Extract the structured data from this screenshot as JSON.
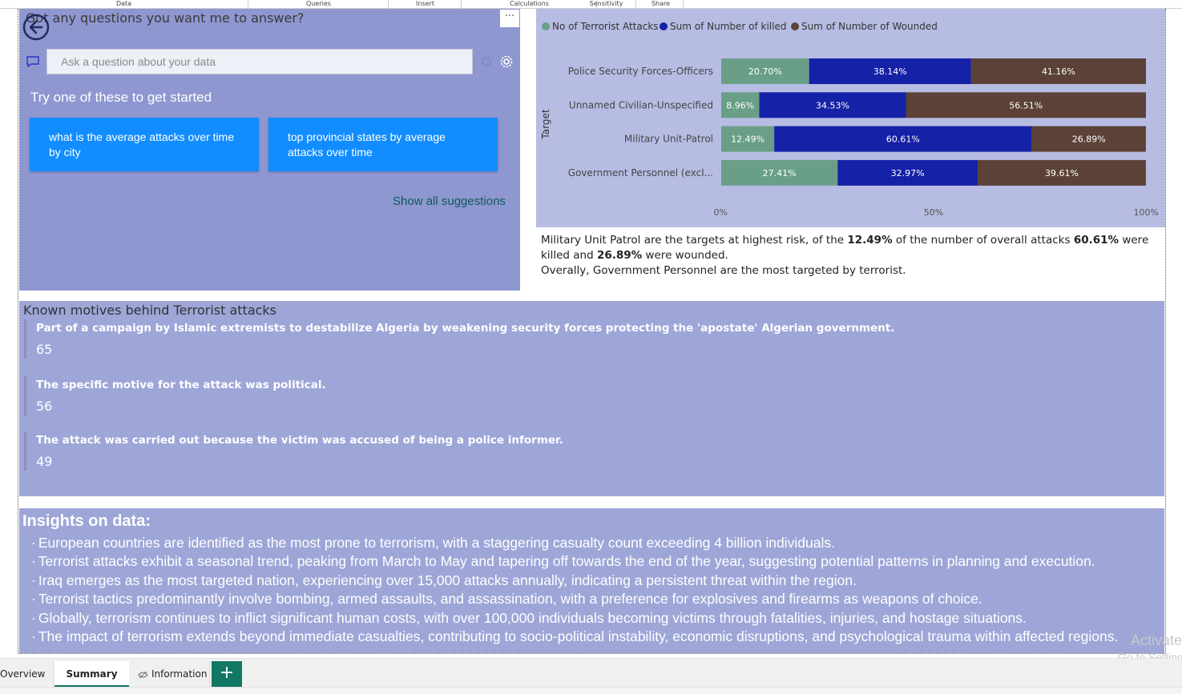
{
  "ribbon": {
    "items": [
      "Data",
      "Queries",
      "Insert",
      "Calculations",
      "Sensitivity",
      "Share"
    ]
  },
  "qa": {
    "title": "Got any questions you want me to answer?",
    "input_placeholder": "Ask a question about your data",
    "more": "···",
    "try_text": "Try one of these to get started",
    "suggestions": [
      "what is the average attacks over time by city",
      "top provincial states by average attacks over time"
    ],
    "show_all": "Show all suggestions"
  },
  "chart_data": {
    "type": "bar",
    "stacked": "100%",
    "orientation": "horizontal",
    "legend_position": "top-left",
    "ylabel": "Target",
    "xlabel": "",
    "xlim": [
      0,
      100
    ],
    "x_ticks": [
      "0%",
      "50%",
      "100%"
    ],
    "categories": [
      "Police Security Forces-Officers",
      "Unnamed Civilian-Unspecified",
      "Military Unit-Patrol",
      "Government Personnel (excl..."
    ],
    "series": [
      {
        "name": "No of Terrorist Attacks",
        "color": "#6a9f87",
        "values": [
          20.7,
          8.96,
          12.49,
          27.41
        ],
        "labels": [
          "20.70%",
          "8.96%",
          "12.49%",
          "27.41%"
        ]
      },
      {
        "name": "Sum of Number of killed",
        "color": "#1521a6",
        "values": [
          38.14,
          34.53,
          60.61,
          32.97
        ],
        "labels": [
          "38.14%",
          "34.53%",
          "60.61%",
          "32.97%"
        ]
      },
      {
        "name": "Sum of Number of Wounded",
        "color": "#5c4236",
        "values": [
          41.16,
          56.51,
          26.89,
          39.61
        ],
        "labels": [
          "41.16%",
          "56.51%",
          "26.89%",
          "39.61%"
        ]
      }
    ]
  },
  "summary": {
    "p1_a": "Military Unit Patrol are the targets at  highest risk, of the ",
    "p1_b": "12.49%",
    "p1_c": "   of the number of overall attacks ",
    "p1_d": "60.61%",
    "p1_e": " were killed and ",
    "p1_f": "26.89%",
    "p1_g": " were wounded.",
    "p2": "Overally, Government Personnel are the most targeted by terrorist."
  },
  "motives": {
    "title": "Known motives behind Terrorist attacks",
    "items": [
      {
        "text": "Part of a campaign by Islamic extremists to destabilize Algeria by weakening security forces protecting the 'apostate' Algerian government.",
        "value": "65"
      },
      {
        "text": "The specific motive for the attack was political.",
        "value": "56"
      },
      {
        "text": "The attack was carried out because the victim was accused of being a police informer.",
        "value": "49"
      }
    ]
  },
  "insights": {
    "title": "Insights on data:",
    "items": [
      "European countries are identified as the most prone to terrorism, with a staggering casualty count exceeding 4 billion individuals.",
      "Terrorist attacks exhibit a seasonal trend, peaking from March to May and tapering off towards the end of the year, suggesting potential patterns in planning and execution.",
      "Iraq emerges as the most targeted nation, experiencing over 15,000 attacks annually, indicating a persistent threat within the region.",
      "Terrorist tactics predominantly involve bombing, armed assaults, and assassination, with a preference for explosives and firearms as weapons of choice.",
      "Globally, terrorism continues to inflict significant human costs, with over 100,000 individuals becoming victims through fatalities, injuries, and hostage situations.",
      "The impact of terrorism extends beyond immediate casualties, contributing to socio-political instability, economic disruptions, and psychological trauma within affected regions."
    ]
  },
  "watermark": {
    "line1": "Activate",
    "line2": "Go to Settings"
  },
  "tabs": {
    "items": [
      "Overview",
      "Summary",
      "Information"
    ],
    "active": "Summary",
    "add": "+"
  }
}
